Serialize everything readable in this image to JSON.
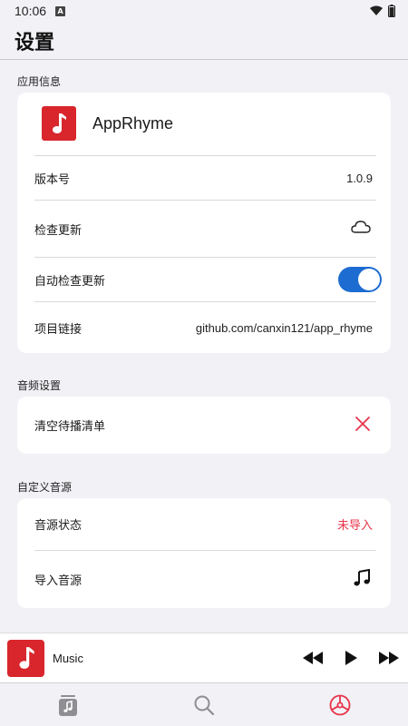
{
  "status_bar": {
    "time": "10:06",
    "notification_badge": "A"
  },
  "header": {
    "title": "设置"
  },
  "sections": {
    "app_info": {
      "title": "应用信息",
      "app_name": "AppRhyme",
      "version_label": "版本号",
      "version_value": "1.0.9",
      "check_update_label": "检查更新",
      "auto_check_label": "自动检查更新",
      "auto_check_enabled": true,
      "project_link_label": "项目链接",
      "project_link_value": "github.com/canxin121/app_rhyme"
    },
    "audio": {
      "title": "音频设置",
      "clear_queue_label": "清空待播清单"
    },
    "custom_source": {
      "title": "自定义音源",
      "source_status_label": "音源状态",
      "source_status_value": "未导入",
      "import_source_label": "导入音源"
    }
  },
  "mini_player": {
    "title": "Music"
  },
  "bottom_nav": {
    "items": [
      "library-icon",
      "search-icon",
      "settings-icon"
    ],
    "active": "settings-icon"
  },
  "colors": {
    "accent_red": "#e8344a",
    "brand_red": "#d8262c",
    "toggle_blue": "#1d6cd1",
    "background": "#f2f1f6"
  }
}
